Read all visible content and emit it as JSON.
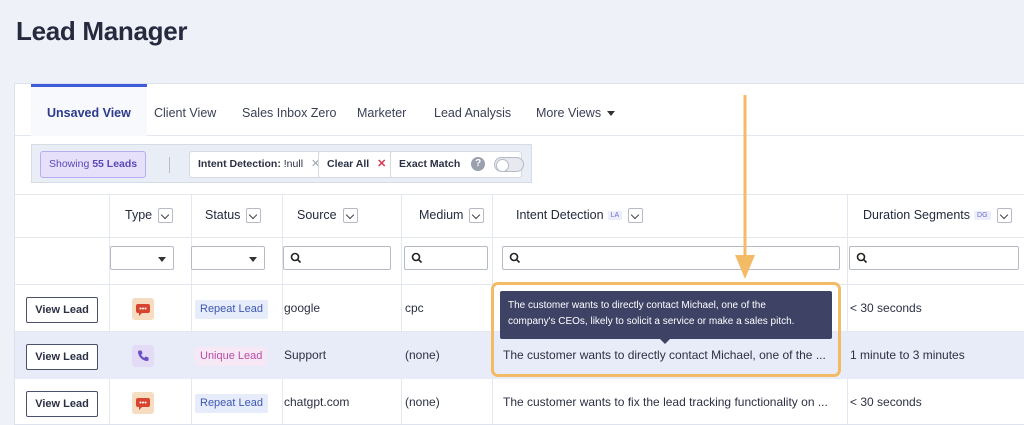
{
  "page": {
    "title": "Lead Manager"
  },
  "tabs": [
    {
      "label": "Unsaved View",
      "active": true
    },
    {
      "label": "Client View"
    },
    {
      "label": "Sales Inbox Zero"
    },
    {
      "label": "Marketer"
    },
    {
      "label": "Lead Analysis"
    },
    {
      "label": "More Views"
    }
  ],
  "filters": {
    "showing_prefix": "Showing",
    "showing_count": "55 Leads",
    "intent_label": "Intent Detection:",
    "intent_value": "!null",
    "clear_all": "Clear All",
    "exact_match": "Exact Match",
    "help_glyph": "?",
    "exact_match_on": false,
    "remove_glyph": "✕"
  },
  "columns": {
    "type": "Type",
    "status": "Status",
    "source": "Source",
    "medium": "Medium",
    "intent": "Intent Detection",
    "intent_tag": "LA",
    "duration": "Duration Segments",
    "duration_tag": "DG"
  },
  "rows": [
    {
      "button": "View Lead",
      "type_icon": "chat-icon",
      "status": "Repeat Lead",
      "source": "google",
      "medium": "cpc",
      "intent": "",
      "duration": "< 30 seconds"
    },
    {
      "button": "View Lead",
      "type_icon": "phone-icon",
      "status": "Unique Lead",
      "source": "Support",
      "medium": "(none)",
      "intent": "The customer wants to directly contact Michael, one of the ...",
      "duration": "1 minute to 3 minutes"
    },
    {
      "button": "View Lead",
      "type_icon": "chat-icon",
      "status": "Repeat Lead",
      "source": "chatgpt.com",
      "medium": "(none)",
      "intent": "The customer wants to fix the lead tracking functionality on ...",
      "duration": "< 30 seconds"
    }
  ],
  "tooltip": {
    "line1": "The customer wants to directly contact Michael, one of the",
    "line2": "company's CEOs, likely to solicit a service or make a sales pitch."
  },
  "colors": {
    "accent": "#3e5bd8",
    "highlight": "#f3bb65",
    "tooltip_bg": "#3e4366",
    "row_highlight": "#e8ecf8"
  }
}
